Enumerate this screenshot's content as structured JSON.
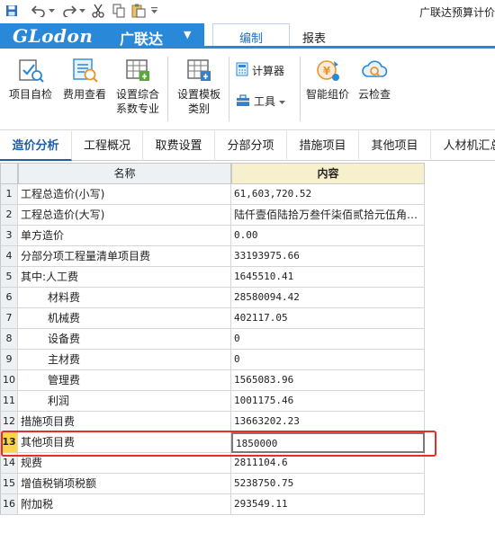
{
  "title_bar": {
    "app_title": "广联达预算计价"
  },
  "brand": {
    "logo_latin": "GLodon",
    "logo_cn": "广联达"
  },
  "menu_tabs": [
    {
      "label": "编制"
    },
    {
      "label": "报表"
    }
  ],
  "ribbon": {
    "project_check": "项目自检",
    "fee_view": "费用查看",
    "set_coef_line1": "设置综合",
    "set_coef_line2": "系数专业",
    "set_template_line1": "设置模板",
    "set_template_line2": "类别",
    "calculator": "计算器",
    "tools": "工具",
    "smart_price": "智能组价",
    "cloud_check": "云检查"
  },
  "nav_tabs": [
    {
      "label": "造价分析"
    },
    {
      "label": "工程概况"
    },
    {
      "label": "取费设置"
    },
    {
      "label": "分部分项"
    },
    {
      "label": "措施项目"
    },
    {
      "label": "其他项目"
    },
    {
      "label": "人材机汇总"
    }
  ],
  "table": {
    "headers": {
      "name": "名称",
      "content": "内容"
    },
    "rows": [
      {
        "no": "1",
        "name": "工程总造价(小写)",
        "value": "61,603,720.52"
      },
      {
        "no": "2",
        "name": "工程总造价(大写)",
        "value": "陆仟壹佰陆拾万叁仟柒佰贰拾元伍角贰分"
      },
      {
        "no": "3",
        "name": "单方造价",
        "value": "0.00"
      },
      {
        "no": "4",
        "name": "分部分项工程量清单项目费",
        "value": "33193975.66"
      },
      {
        "no": "5",
        "name": "其中:人工费",
        "value": "1645510.41"
      },
      {
        "no": "6",
        "name": "材料费",
        "value": "28580094.42"
      },
      {
        "no": "7",
        "name": "机械费",
        "value": "402117.05"
      },
      {
        "no": "8",
        "name": "设备费",
        "value": "0"
      },
      {
        "no": "9",
        "name": "主材费",
        "value": "0"
      },
      {
        "no": "10",
        "name": "管理费",
        "value": "1565083.96"
      },
      {
        "no": "11",
        "name": "利润",
        "value": "1001175.46"
      },
      {
        "no": "12",
        "name": "措施项目费",
        "value": "13663202.23"
      },
      {
        "no": "13",
        "name": "其他项目费",
        "value": "1850000"
      },
      {
        "no": "14",
        "name": "规费",
        "value": "2811104.6"
      },
      {
        "no": "15",
        "name": "增值税销项税额",
        "value": "5238750.75"
      },
      {
        "no": "16",
        "name": "附加税",
        "value": "293549.11"
      }
    ],
    "selected_row": "13"
  },
  "colors": {
    "brand_blue": "#2a88d8",
    "highlight_red": "#e0302a",
    "selected_row_number": "#ffd54a",
    "content_header": "#f7f0cc"
  },
  "icons": {
    "save": "save-icon",
    "undo": "undo-icon",
    "redo": "redo-icon",
    "cut": "scissors-icon",
    "copy": "copy-icon",
    "paste": "paste-icon"
  }
}
